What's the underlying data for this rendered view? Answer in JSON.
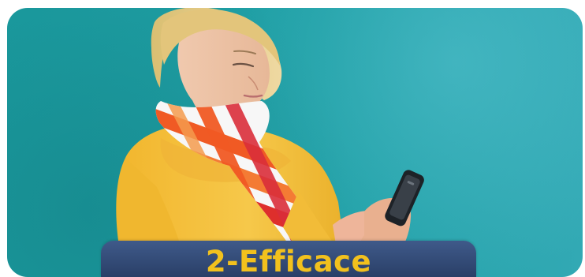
{
  "caption": {
    "title": "2-Efficace"
  },
  "colors": {
    "background_teal": "#20a0a6",
    "banner_navy": "#2a3f67",
    "caption_yellow": "#f2c11d",
    "sweater_yellow": "#f4c542",
    "scarf_orange": "#f05a24"
  }
}
